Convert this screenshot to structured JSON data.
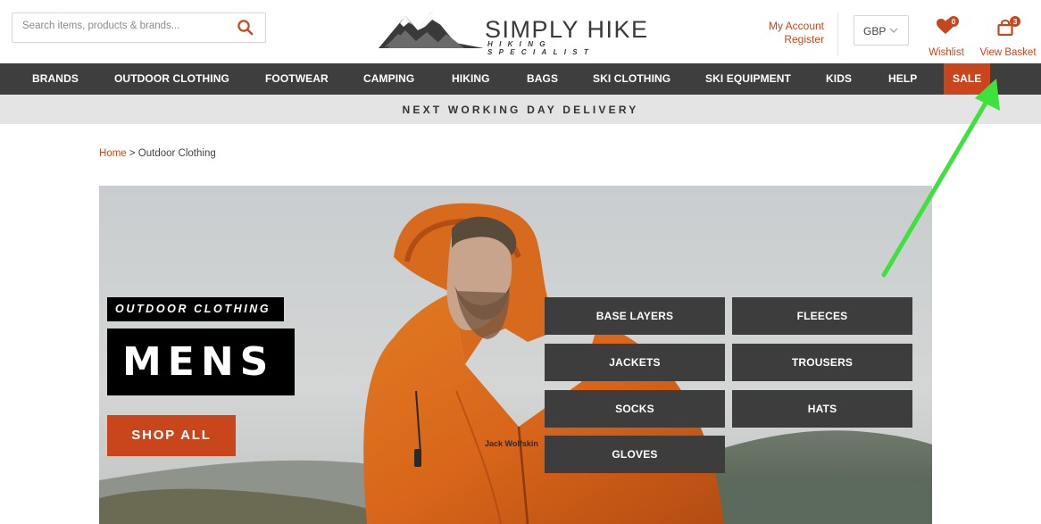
{
  "header": {
    "search_placeholder": "Search items, products & brands...",
    "logo_name": "SIMPLY HIKE",
    "logo_tagline": "HIKING SPECIALIST",
    "account": {
      "my_account": "My Account",
      "register": "Register"
    },
    "currency": "GBP",
    "wishlist": {
      "label": "Wishlist",
      "count": "0"
    },
    "basket": {
      "label": "View Basket",
      "count": "3"
    }
  },
  "nav": {
    "items": [
      {
        "label": "BRANDS"
      },
      {
        "label": "OUTDOOR CLOTHING"
      },
      {
        "label": "FOOTWEAR"
      },
      {
        "label": "CAMPING"
      },
      {
        "label": "HIKING"
      },
      {
        "label": "BAGS"
      },
      {
        "label": "SKI CLOTHING"
      },
      {
        "label": "SKI EQUIPMENT"
      },
      {
        "label": "KIDS"
      },
      {
        "label": "HELP"
      },
      {
        "label": "SALE"
      }
    ]
  },
  "delivery_banner": "NEXT WORKING DAY DELIVERY",
  "breadcrumb": {
    "home": "Home",
    "separator": " > ",
    "current": "Outdoor Clothing"
  },
  "hero": {
    "kicker": "OUTDOOR CLOTHING",
    "headline": "MENS",
    "cta": "SHOP ALL",
    "jacket_brand": "Jack Wolfskin",
    "categories": [
      {
        "label": "BASE LAYERS"
      },
      {
        "label": "FLEECES"
      },
      {
        "label": "JACKETS"
      },
      {
        "label": "TROUSERS"
      },
      {
        "label": "SOCKS"
      },
      {
        "label": "HATS"
      },
      {
        "label": "GLOVES"
      }
    ]
  },
  "colors": {
    "accent": "#c9451c",
    "nav_bg": "#3e3e3e",
    "banner_bg": "#e4e4e4",
    "category_button_bg": "#3d3d3d",
    "annotation_arrow": "#3ee23e"
  },
  "icons": {
    "search": "search-icon",
    "currency_dropdown": "chevron-down-icon",
    "wishlist": "heart-icon",
    "basket": "shopping-bag-icon",
    "logo": "mountain-icon"
  }
}
